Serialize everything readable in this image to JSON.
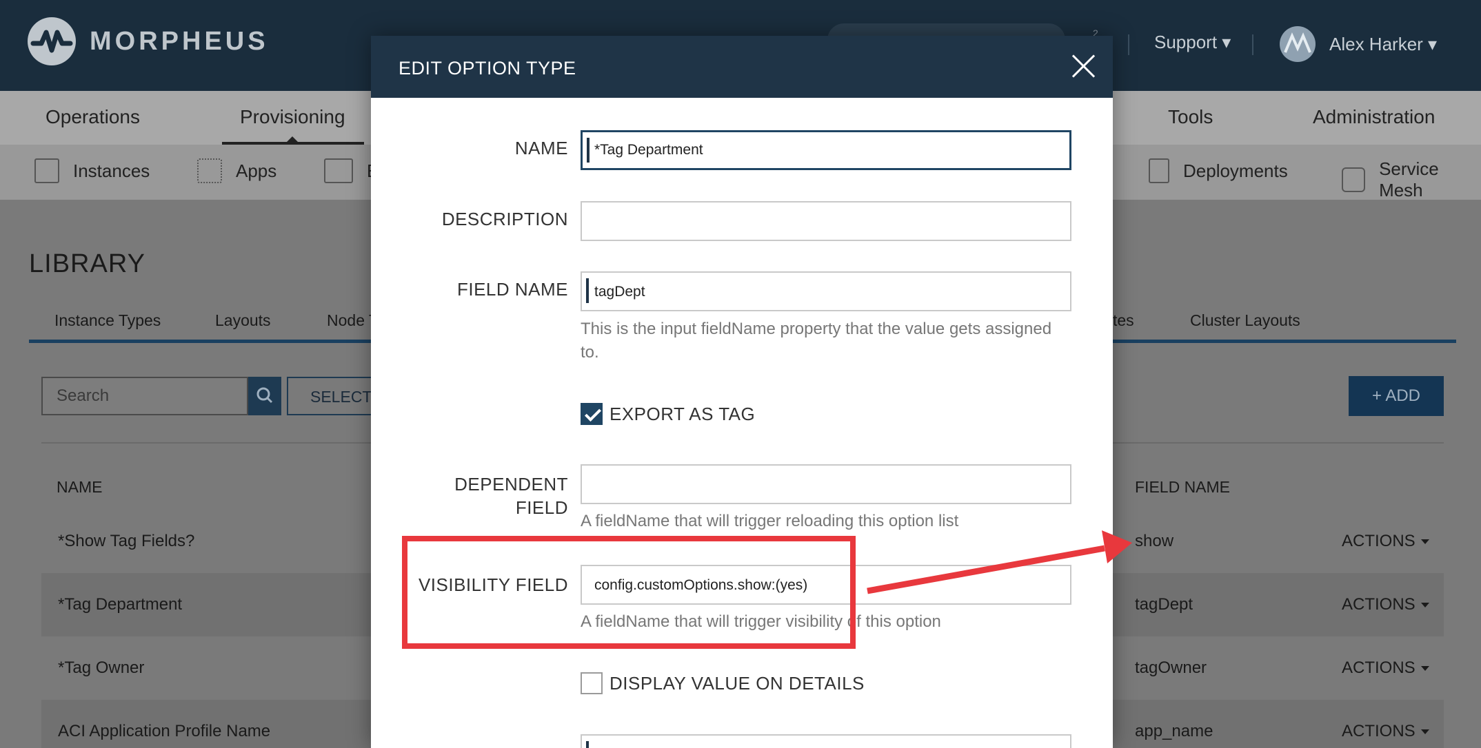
{
  "app": {
    "brand": "MORPHEUS",
    "support_label": "Support",
    "user_name": "Alex Harker",
    "notification_count": "2"
  },
  "main_nav": [
    "Operations",
    "Provisioning",
    "Tools",
    "Administration"
  ],
  "sub_nav": [
    "Instances",
    "Apps",
    "E",
    "Deployments",
    "Service Mesh"
  ],
  "library": {
    "title": "LIBRARY",
    "tabs": [
      "Instance Types",
      "Layouts",
      "Node T",
      "tes",
      "Cluster Layouts"
    ],
    "search_placeholder": "Search",
    "select_label": "SELECT",
    "add_label": "+ ADD",
    "columns": [
      "NAME",
      "FIELD NAME"
    ],
    "rows": [
      {
        "name": "*Show Tag Fields?",
        "field": "show",
        "action": "ACTIONS"
      },
      {
        "name": "*Tag Department",
        "field": "tagDept",
        "action": "ACTIONS"
      },
      {
        "name": "*Tag Owner",
        "field": "tagOwner",
        "action": "ACTIONS"
      },
      {
        "name": "ACI Application Profile Name",
        "field": "app_name",
        "action": "ACTIONS"
      }
    ]
  },
  "modal": {
    "title": "EDIT OPTION TYPE",
    "name_label": "NAME",
    "name_value": "*Tag Department",
    "description_label": "DESCRIPTION",
    "description_value": "",
    "field_name_label": "FIELD NAME",
    "field_name_value": "tagDept",
    "field_name_help": "This is the input fieldName property that the value gets assigned to.",
    "export_as_tag_label": "EXPORT AS TAG",
    "export_as_tag_checked": true,
    "dependent_label_1": "DEPENDENT",
    "dependent_label_2": "FIELD",
    "dependent_value": "",
    "dependent_help": "A fieldName that will trigger reloading this option list",
    "visibility_label": "VISIBILITY FIELD",
    "visibility_value": "config.customOptions.show:(yes)",
    "visibility_help": "A fieldName that will trigger visibility of this option",
    "display_value_label": "DISPLAY VALUE ON DETAILS",
    "display_value_checked": false
  },
  "colors": {
    "header_dark": "#1a2d3d",
    "modal_header": "#1f3447",
    "annotation_red": "#e8383d"
  }
}
